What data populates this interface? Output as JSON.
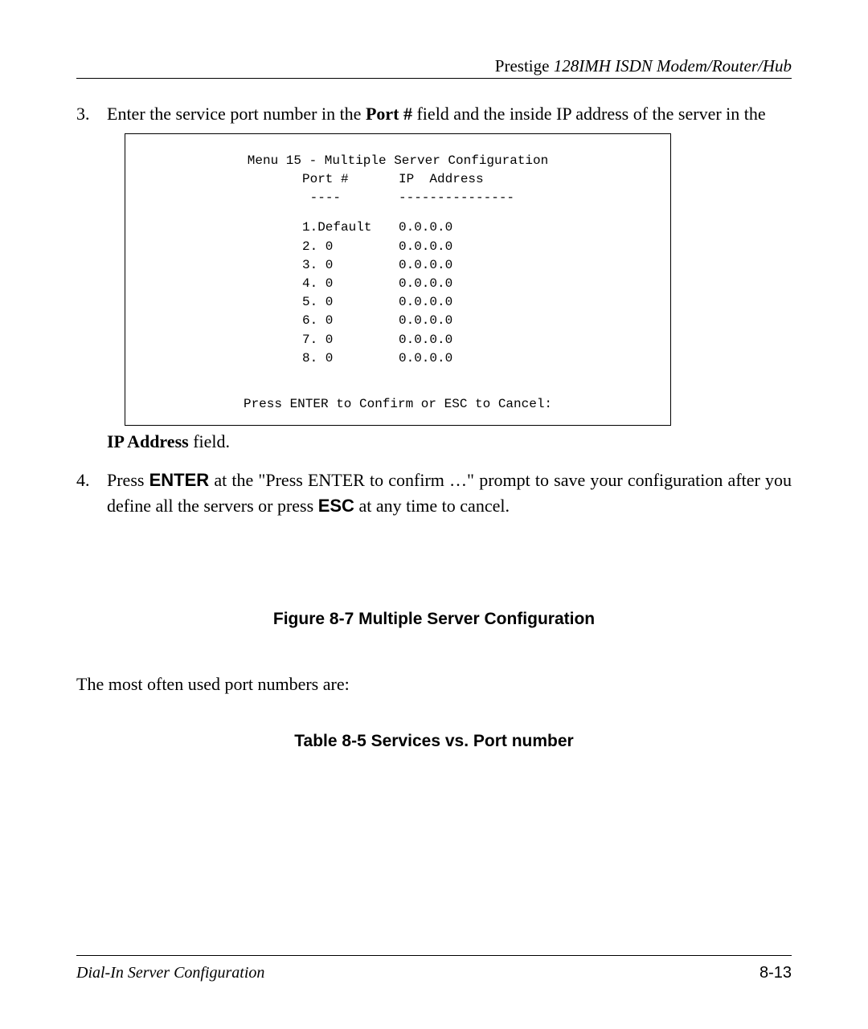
{
  "header": {
    "product": "Prestige",
    "model_doc": "128IMH  ISDN Modem/Router/Hub"
  },
  "steps": {
    "s3": {
      "num": "3.",
      "pre": "Enter the service port number in the ",
      "bold1": "Port #",
      "mid": " field and the inside IP address of the server in the",
      "post_line_bold": "IP Address",
      "post_line_tail": " field."
    },
    "s4": {
      "num": "4.",
      "a": "Press ",
      "enter": "ENTER",
      "b": " at the \"Press ENTER to confirm …\" prompt to save your configuration after you define all the servers or press ",
      "esc": "ESC",
      "c": " at any time to cancel."
    }
  },
  "terminal": {
    "title": "Menu 15 - Multiple Server Configuration",
    "header_port": "Port #",
    "header_ip": "IP  Address",
    "dashes_port": "----",
    "dashes_ip": "---------------",
    "rows": [
      {
        "port": "1.Default",
        "ip": "0.0.0.0"
      },
      {
        "port": "2. 0",
        "ip": "0.0.0.0"
      },
      {
        "port": "3. 0",
        "ip": "0.0.0.0"
      },
      {
        "port": "4. 0",
        "ip": "0.0.0.0"
      },
      {
        "port": "5. 0",
        "ip": "0.0.0.0"
      },
      {
        "port": "6. 0",
        "ip": "0.0.0.0"
      },
      {
        "port": "7. 0",
        "ip": "0.0.0.0"
      },
      {
        "port": "8. 0",
        "ip": "0.0.0.0"
      }
    ],
    "footer": "Press ENTER to Confirm or ESC to Cancel:"
  },
  "figure_caption": "Figure 8-7 Multiple Server Configuration",
  "paragraph": "The most often used port numbers are:",
  "table_caption": "Table 8-5 Services vs. Port number",
  "footer": {
    "left": "Dial-In Server Configuration",
    "right": "8-13"
  }
}
